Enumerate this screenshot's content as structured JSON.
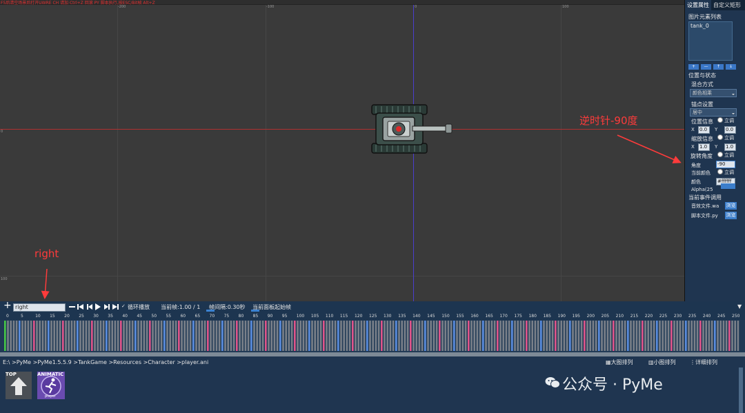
{
  "status_line": "F5后清空场景后打开UWRE CH 请加 Ctrl+Z 回滚 PY 脚本执行,按ESC/Bit帧 Alt+Z",
  "viewport": {
    "ruler_top_ticks": [
      "-200",
      "-100",
      "0",
      "100"
    ],
    "ruler_left_ticks": [
      "0",
      "100"
    ]
  },
  "sprite": {
    "name": "tank_0"
  },
  "annotations": {
    "rotation_note": "逆时针-90度",
    "animation_note": "right"
  },
  "panel": {
    "tabs": [
      "设置属性",
      "自定义矩形"
    ],
    "active_tab": 0,
    "element_list_title": "图片元素列表",
    "element_list": [
      "tank_0"
    ],
    "list_buttons": [
      "+",
      "—",
      "↑",
      "↓"
    ],
    "position_state_title": "位置与状态",
    "blend_label": "混合方式",
    "blend_value": "颜色相乘",
    "anchor_label": "锚点设置",
    "anchor_value": "居中",
    "position_label": "位置信息",
    "position_x_label": "X",
    "position_x": "0.0",
    "position_y_label": "Y",
    "position_y": "0.0",
    "scale_label": "缩放信息",
    "scale_x_label": "X",
    "scale_x": "1.0",
    "scale_y_label": "Y",
    "scale_y": "1.0",
    "rotation_label": "旋转角度",
    "angle_label": "角度",
    "angle_value": "-90",
    "current_color_label": "当前颜色",
    "color_label": "颜色",
    "color_value": "#ffffff",
    "alpha_label": "Alpha(25",
    "radio_label": "立调",
    "events_title": "当前事件调用",
    "sound_file_label": "音效文件.wa",
    "script_file_label": "脚本文件.py",
    "browse_label": "浏览"
  },
  "timeline": {
    "add_label": "+",
    "animation_select": "right",
    "loop_label": "循环播放",
    "current_frame_text": "当前帧:1.00 / 1",
    "frame_interval_text": "帧间隔:0.30秒",
    "panel_start_text": "当前面板起始帧",
    "frame_numbers": [
      "0",
      "5",
      "10",
      "15",
      "20",
      "25",
      "30",
      "35",
      "40",
      "45",
      "50",
      "55",
      "60",
      "65",
      "70",
      "75",
      "80",
      "85",
      "90",
      "95",
      "100",
      "105",
      "110",
      "115",
      "120",
      "125",
      "130",
      "135",
      "140",
      "145",
      "150",
      "155",
      "160",
      "165",
      "170",
      "175",
      "180",
      "185",
      "190",
      "195",
      "200",
      "205",
      "210",
      "215",
      "220",
      "225",
      "230",
      "235",
      "240",
      "245",
      "250"
    ],
    "colors": {
      "keyframe": "#46c846",
      "blue_marker": "#5a8de0",
      "pink_marker": "#e0558a",
      "gray_cell": "#7a8089"
    }
  },
  "browser": {
    "path": "E:\\ >PyMe >PyMe1.5.5.9 >TankGame >Resources >Character >player.ani",
    "view_options": [
      "大图排列",
      "小图排列",
      "详细排列"
    ],
    "tiles": [
      {
        "label": "TOP",
        "icon": "up-arrow-icon"
      },
      {
        "label": "ANIMATIC",
        "caption": "player",
        "icon": "running-man-icon"
      }
    ],
    "watermark": "公众号 · PyMe"
  }
}
